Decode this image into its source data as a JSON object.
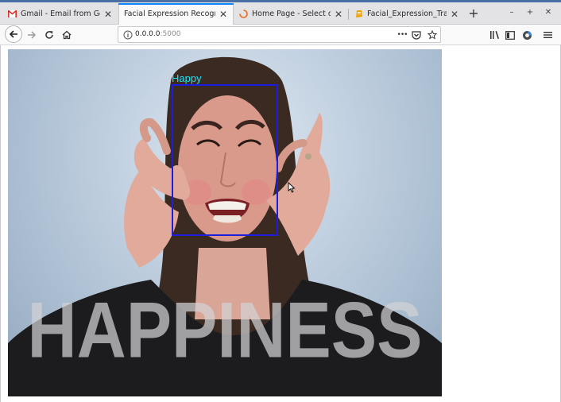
{
  "browser": {
    "tabs": [
      {
        "label": "Gmail - Email from Google",
        "favicon": "gmail-icon",
        "active": false
      },
      {
        "label": "Facial Expression Recognition",
        "favicon": "",
        "active": true
      },
      {
        "label": "Home Page - Select or crea",
        "favicon": "loading-spinner-icon",
        "active": false
      },
      {
        "label": "Facial_Expression_Training",
        "favicon": "jupyter-icon",
        "active": false
      }
    ],
    "new_tab_symbol": "+",
    "window_controls": {
      "minimize": "–",
      "maximize": "+",
      "close": "✕"
    }
  },
  "navbar": {
    "url_host": "0.0.0.0",
    "url_port": ":5000",
    "page_actions_symbol": "•••"
  },
  "video": {
    "detected_label": "Happy",
    "caption_text": "HAPPINESS",
    "box_color": "#1d1de0",
    "label_color": "#18e6ff"
  },
  "colors": {
    "tab_strip": "#e3e3e6",
    "active_tab_highlight": "#0a84ff",
    "toolbar": "#f9f9fa"
  }
}
